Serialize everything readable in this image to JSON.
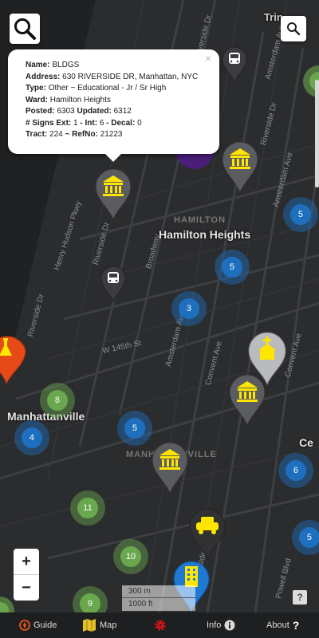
{
  "map": {
    "street_labels": [
      "Riverside Dr",
      "Riverside Dr",
      "Henry Hudson Pkwy",
      "Riverside Dr",
      "Broadway",
      "Amsterdam Ave",
      "Amsterdam Ave",
      "Convent Ave",
      "Amsterdam Ave",
      "W 145th St",
      "Riverside Dr",
      "Convent Ave",
      "Powell Blvd",
      "Riverside Dr"
    ],
    "neighborhoods": {
      "hamilton_heights_faint": "HAMILTON",
      "hamilton_heights": "Hamilton Heights",
      "manhattanville": "Manhattanville",
      "manhattanville_faint": "MANHATTANVILLE",
      "trinity_partial": "Trin",
      "ce_partial": "Ce"
    },
    "clusters": [
      {
        "id": "c1",
        "count": "5",
        "color": "#1f6fbf"
      },
      {
        "id": "c2",
        "count": "5",
        "color": "#1f6fbf"
      },
      {
        "id": "c3",
        "count": "3",
        "color": "#1f6fbf"
      },
      {
        "id": "c4",
        "count": "8",
        "color": "#6aa84f"
      },
      {
        "id": "c5",
        "count": "4",
        "color": "#1f6fbf"
      },
      {
        "id": "c6",
        "count": "5",
        "color": "#1f6fbf"
      },
      {
        "id": "c7",
        "count": "6",
        "color": "#1f6fbf"
      },
      {
        "id": "c8",
        "count": "11",
        "color": "#6aa84f"
      },
      {
        "id": "c9",
        "count": "10",
        "color": "#6aa84f"
      },
      {
        "id": "c10",
        "count": "5",
        "color": "#1f6fbf"
      },
      {
        "id": "c11",
        "count": "9",
        "color": "#6aa84f"
      }
    ]
  },
  "popup": {
    "name_label": "Name:",
    "name_value": "BLDGS",
    "address_label": "Address:",
    "address_value": "630 RIVERSIDE DR, Manhattan, NYC",
    "type_label": "Type:",
    "type_value": "Other ~ Educational - Jr / Sr High",
    "ward_label": "Ward:",
    "ward_value": "Hamilton Heights",
    "posted_label": "Posted:",
    "posted_value": "6303",
    "updated_label": "Updated:",
    "updated_value": "6312",
    "signs_label": "# Signs Ext:",
    "signs_ext": "1",
    "int_label": "- Int:",
    "int_value": "6",
    "decal_label": "- Decal:",
    "decal_value": "0",
    "tract_label": "Tract:",
    "tract_value": "224",
    "refno_label": "~ RefNo:",
    "refno_value": "21223",
    "close": "×"
  },
  "controls": {
    "zoom_in": "+",
    "zoom_out": "−",
    "help": "?",
    "scale_metric": "300 m",
    "scale_imperial": "1000 ft"
  },
  "bottom_nav": {
    "guide": "Guide",
    "map": "Map",
    "info": "Info",
    "about": "About"
  }
}
